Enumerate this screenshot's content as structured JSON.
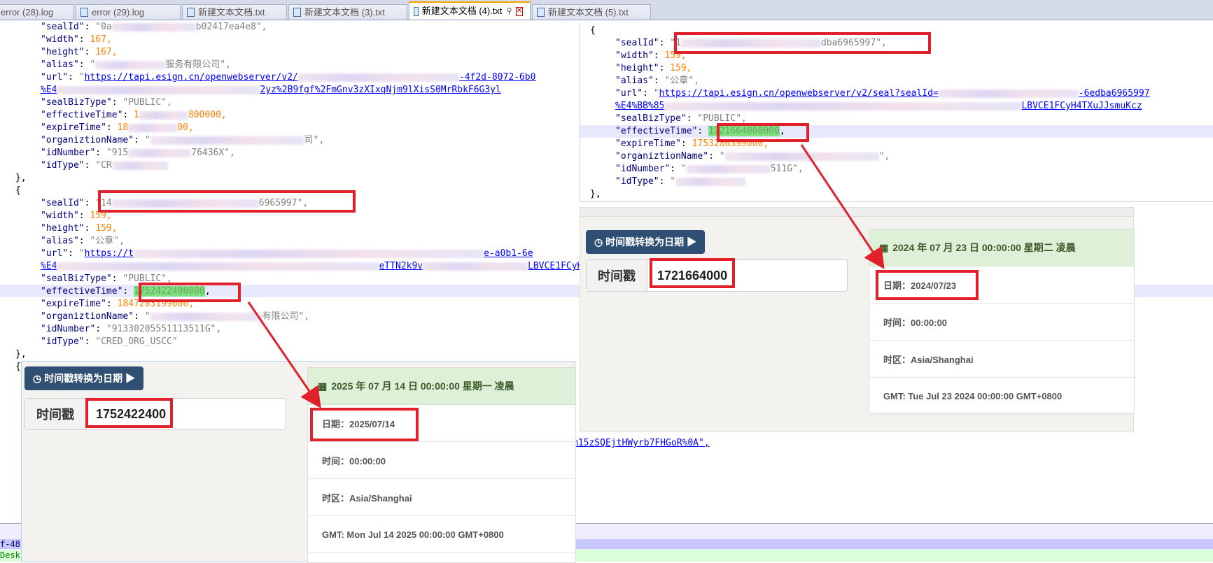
{
  "tabs": [
    {
      "label": "error (28).log",
      "active": false
    },
    {
      "label": "error (29).log",
      "active": false
    },
    {
      "label": "新建文本文档.txt",
      "active": false
    },
    {
      "label": "新建文本文档 (3).txt",
      "active": false
    },
    {
      "label": "新建文本文档 (4).txt",
      "active": true
    },
    {
      "label": "新建文本文档 (5).txt",
      "active": false
    }
  ],
  "left_code": {
    "l1": {
      "key": "\"sealId\"",
      "v1": "\"0a",
      "v2": "b02417ea4e8\","
    },
    "l2": {
      "key": "\"width\"",
      "val": "167,"
    },
    "l3": {
      "key": "\"height\"",
      "val": "167,"
    },
    "l4": {
      "key": "\"alias\"",
      "v1": "\"",
      "v2": "服务有限公司\","
    },
    "l5": {
      "key": "\"url\"",
      "v1": "https://tapi.esign.cn/openwebserver/v2/",
      "v2": "-4f2d-8072-6b0"
    },
    "l6": {
      "v1": "%E4",
      "v2": "2yz%2B9fgf%2FmGnv3zXIxqNjm9lXisS0MrRbkF6G3yl"
    },
    "l7": {
      "key": "\"sealBizType\"",
      "val": "\"PUBLIC\","
    },
    "l8": {
      "key": "\"effectiveTime\"",
      "v1": "1",
      "v2": "800000,"
    },
    "l9": {
      "key": "\"expireTime\"",
      "v1": "18",
      "v2": "00,"
    },
    "l10": {
      "key": "\"organiztionName\"",
      "v1": "\"",
      "v2": "司\","
    },
    "l11": {
      "key": "\"idNumber\"",
      "v1": "\"915",
      "v2": "76436X\","
    },
    "l12": {
      "key": "\"idType\"",
      "v1": "\"CR"
    },
    "l13": "},",
    "l14": "{",
    "l15": {
      "key": "\"sealId\"",
      "v1": "\"14",
      "v2": "6965997\","
    },
    "l16": {
      "key": "\"width\"",
      "val": "159,"
    },
    "l17": {
      "key": "\"height\"",
      "val": "159,"
    },
    "l18": {
      "key": "\"alias\"",
      "val": "\"公章\","
    },
    "l19": {
      "key": "\"url\"",
      "v1": "https://t",
      "v2": "e-a0b1-6e"
    },
    "l20": {
      "v1": "%E4",
      "v2": "eTTN2k9v",
      "v3": "LBVCE1FCyH4TX"
    },
    "l21": {
      "key": "\"sealBizType\"",
      "val": "\"PUBLIC\","
    },
    "l22": {
      "key": "\"effectiveTime\"",
      "val": "1752422400000",
      "tail": ","
    },
    "l23": {
      "key": "\"expireTime\"",
      "val": "1847203199000,"
    },
    "l24": {
      "key": "\"organiztionName\"",
      "v1": "\"",
      "v2": "有限公司\","
    },
    "l25": {
      "key": "\"idNumber\"",
      "val": "\"91330205551113511G\","
    },
    "l26": {
      "key": "\"idType\"",
      "val": "\"CRED_ORG_USCC\""
    },
    "l27": "},",
    "l28": "{"
  },
  "right_code": {
    "r1": "{",
    "r2": {
      "key": "\"sealId\"",
      "v1": "\"1",
      "v2": "dba6965997\","
    },
    "r3": {
      "key": "\"width\"",
      "val": "159,"
    },
    "r4": {
      "key": "\"height\"",
      "val": "159,"
    },
    "r5": {
      "key": "\"alias\"",
      "val": "\"公章\","
    },
    "r6": {
      "key": "\"url\"",
      "v1": "https://tapi.esign.cn/openwebserver/v2/seal?sealId=",
      "v2": "-6edba6965997"
    },
    "r7": {
      "v1": "%E4%BB%85",
      "v2": "LBVCE1FCyH4TXuJJsmuKcz"
    },
    "r8": {
      "key": "\"sealBizType\"",
      "val": "\"PUBLIC\","
    },
    "r9": {
      "key": "\"effectiveTime\"",
      "val": "1721664000000",
      "tail": ","
    },
    "r10": {
      "key": "\"expireTime\"",
      "val": "1753286399000,"
    },
    "r11": {
      "key": "\"organiztionName\"",
      "v1": "\"",
      "v2": "\","
    },
    "r12": {
      "key": "\"idNumber\"",
      "v1": "\"",
      "v2": "511G\","
    },
    "r13": {
      "key": "\"idType\"",
      "v1": "\""
    },
    "r14": "},"
  },
  "bg_fragments": {
    "f1": "m15zSQEjtHWyrb7FHGoR%0A\","
  },
  "bottom": {
    "line1": "f-48",
    "line2": "Desk"
  },
  "converter_left": {
    "button": "时间戳转换为日期",
    "label": "时间戳",
    "value": "1752422400",
    "header": "2025 年 07 月 14 日 00:00:00 星期一 凌晨",
    "rows": [
      "日期：2025/07/14",
      "时间：00:00:00",
      "时区：Asia/Shanghai",
      "GMT:  Mon Jul 14 2025 00:00:00 GMT+0800"
    ]
  },
  "converter_right": {
    "button": "时间戳转换为日期",
    "label": "时间戳",
    "value": "1721664000",
    "header": "2024 年 07 月 23 日 00:00:00 星期二 凌晨",
    "rows": [
      "日期：2024/07/23",
      "时间：00:00:00",
      "时区：Asia/Shanghai",
      "GMT:  Tue Jul 23 2024 00:00:00 GMT+0800"
    ]
  },
  "colors": {
    "highlight_red": "#e0202a",
    "button": "#2f4f73",
    "success_bg": "#dff0d8"
  }
}
